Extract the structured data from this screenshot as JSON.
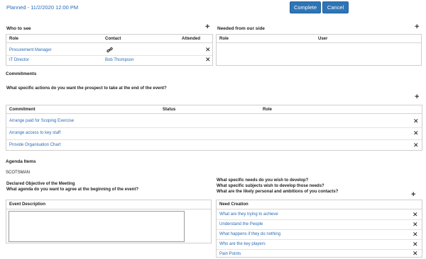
{
  "header": {
    "status": "Planned - 11/2/2020 12:00 PM",
    "complete_label": "Complete",
    "cancel_label": "Cancel"
  },
  "who_to_see": {
    "title": "Who to see",
    "columns": [
      "Role",
      "Contact",
      "Attended"
    ],
    "rows": [
      {
        "role": "Procurement Manager",
        "contact": ""
      },
      {
        "role": "IT Director",
        "contact": "Bob Thompson"
      }
    ]
  },
  "needed": {
    "title": "Needed from our side",
    "columns": [
      "Role",
      "User"
    ]
  },
  "commitments": {
    "title": "Commitments",
    "question": "What specific actions do you want the prospect to take at the end of the event?",
    "columns": [
      "Commitment",
      "Status",
      "Role"
    ],
    "rows": [
      "Arrange paid for Scoping Exercise",
      "Arrange access to key staff",
      "Provide Organisation Chart"
    ]
  },
  "agenda": {
    "title": "Agenda Items",
    "company": "SCOTSMAN",
    "objective_label": "Declared Objective of the Meeting",
    "objective_question": "What agenda do you want to agree at the beginning of the event?",
    "event_desc_header": "Event Description",
    "event_desc_value": ""
  },
  "needs": {
    "questions": [
      "What specific needs do you wish to develop?",
      "What specific subjects wish to develop those needs?",
      "What are the likely personal and ambitions of you contacts?"
    ],
    "header": "Need Creation",
    "rows": [
      "What are they trying to achieve",
      "Understand the People",
      "What happens if they do nothing",
      "Who are the key players",
      "Pain Points"
    ]
  },
  "colors": {
    "accent": "#2e75b6",
    "link": "#2a6ab5"
  },
  "icons": {
    "add": "plus-icon",
    "remove": "close-icon",
    "link": "link-icon"
  }
}
